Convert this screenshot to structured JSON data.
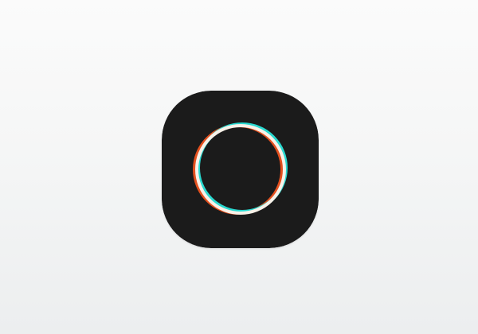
{
  "background": {
    "color_top": "#fbfbfb",
    "color_bottom": "#eceeef"
  },
  "app_icon": {
    "name": "ring-logo-icon",
    "tile_color": "#1b1b1b",
    "ring_colors": {
      "main": "#f8f1e8",
      "left_offset": "#e4501e",
      "right_offset": "#29d9d0"
    }
  }
}
